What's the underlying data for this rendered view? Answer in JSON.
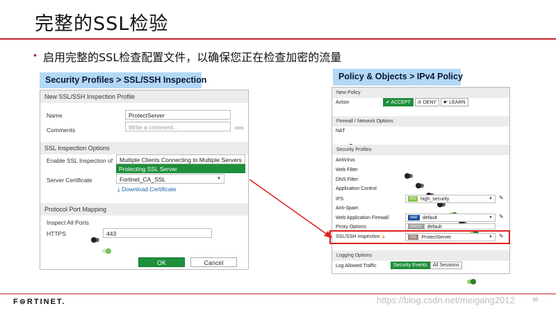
{
  "slide": {
    "title": "完整的SSL检验",
    "bullet": "启用完整的SSL检查配置文件，以确保您正在检查加密的流量",
    "logo": "F⊜RTINET.",
    "watermark": "https://blog.csdn.net/meigang2012",
    "page_number": "10"
  },
  "left": {
    "label": "Security Profiles > SSL/SSH Inspection",
    "panel_header": "New SSL/SSH Inspection Profile",
    "name_label": "Name",
    "name_value": "ProtectServer",
    "comments_label": "Comments",
    "comments_placeholder": "Write a comment...",
    "comments_counter": "0/255",
    "ssl_section": "SSL Inspection Options",
    "enable_label": "Enable SSL Inspection of",
    "option_multiple": "Multiple Clients Connecting to Multiple Servers",
    "option_protecting": "Protecting SSL Server",
    "server_cert_label": "Server Certificate",
    "server_cert_value": "Fortinet_CA_SSL",
    "download_cert": "Download Certificate",
    "port_section": "Protocol Port Mapping",
    "inspect_all_ports": "Inspect All Ports",
    "https_label": "HTTPS",
    "https_port": "443",
    "ok_button": "OK",
    "cancel_button": "Cancel"
  },
  "right": {
    "label": "Policy & Objects > IPv4 Policy",
    "new_policy": "New Policy",
    "action_label": "Action",
    "accept": "✔ ACCEPT",
    "deny": "⊘ DENY",
    "learn": "☛ LEARN",
    "fw_section": "Firewall / Network Options",
    "nat_label": "NAT",
    "sec_section": "Security Profiles",
    "antivirus": "AntiVirus",
    "web_filter": "Web Filter",
    "dns_filter": "DNS Filter",
    "app_control": "Application Control",
    "ips": "IPS",
    "ips_tag": "IPS",
    "ips_value": "high_security",
    "anti_spam": "Anti-Spam",
    "waf": "Web Application Firewall",
    "waf_tag": "WAF",
    "waf_value": "default",
    "proxy_options": "Proxy Options",
    "proxy_tag": "PROXY",
    "proxy_value": "default",
    "ssl_inspection": "SSL/SSH Inspection",
    "ssl_tag": "SSL",
    "ssl_value": "ProtectServer",
    "logging_section": "Logging Options",
    "log_allowed": "Log Allowed Traffic",
    "security_events": "Security Events",
    "all_sessions": "All Sessions"
  },
  "colors": {
    "accent_red": "#c0262d",
    "green": "#1e8f3a",
    "label_blue": "#b3d8f6"
  }
}
